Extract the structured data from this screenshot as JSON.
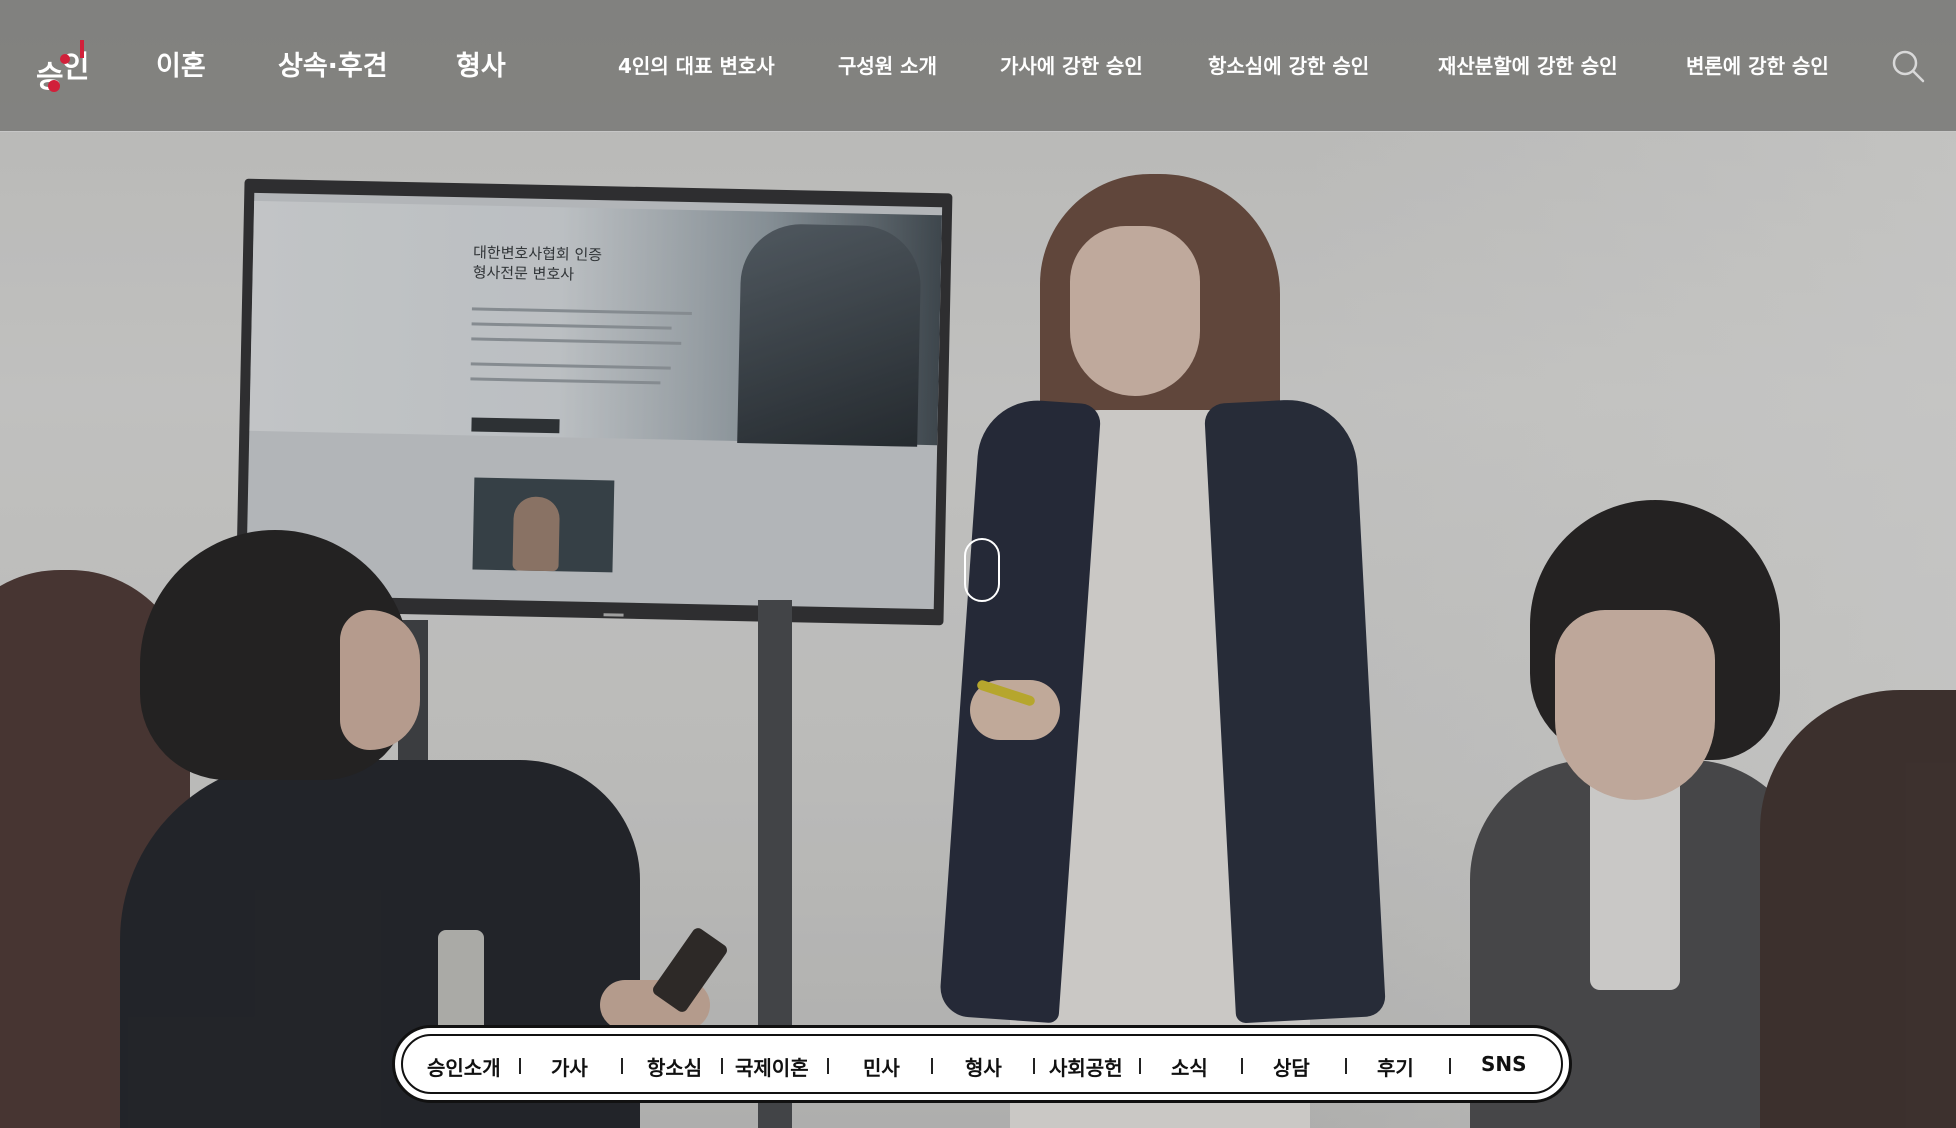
{
  "header": {
    "logo_text": "승인",
    "main_nav": [
      {
        "label": "이혼"
      },
      {
        "label": "상속·후견"
      },
      {
        "label": "형사"
      }
    ],
    "sub_nav": [
      {
        "label": "4인의 대표 변호사"
      },
      {
        "label": "구성원 소개"
      },
      {
        "label": "가사에 강한 승인"
      },
      {
        "label": "항소심에 강한 승인"
      },
      {
        "label": "재산분할에 강한 승인"
      },
      {
        "label": "변론에 강한 승인"
      }
    ],
    "search_icon": "search-icon"
  },
  "hero": {
    "tv_screen_text": [
      "대한변호사협회 인증",
      "형사전문 변호사"
    ]
  },
  "bottom_nav": {
    "items": [
      {
        "label": "승인소개"
      },
      {
        "label": "가사"
      },
      {
        "label": "항소심"
      },
      {
        "label": "국제이혼"
      },
      {
        "label": "민사"
      },
      {
        "label": "형사"
      },
      {
        "label": "사회공헌"
      },
      {
        "label": "소식"
      },
      {
        "label": "상담"
      },
      {
        "label": "후기"
      },
      {
        "label": "SNS"
      }
    ]
  },
  "colors": {
    "header_bg": "#7a7a78",
    "brand_red": "#d1203a",
    "nav_text": "#ffffff",
    "pill_bg": "#ffffff",
    "pill_border": "#111111"
  }
}
